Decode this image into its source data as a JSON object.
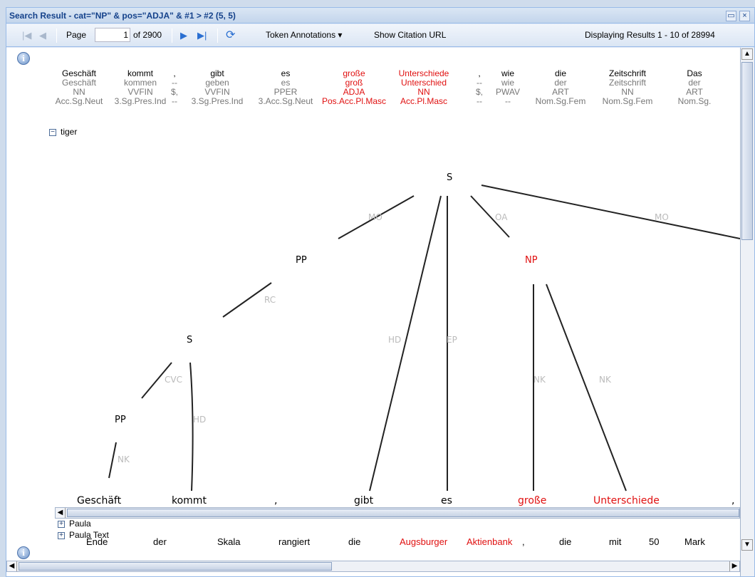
{
  "window": {
    "title": "Search Result - cat=\"NP\" & pos=\"ADJA\" & #1 > #2 (5, 5)",
    "restore_glyph": "▭",
    "close_glyph": "×"
  },
  "toolbar": {
    "page_label": "Page",
    "page_value": "1",
    "of_pages": "of 2900",
    "token_annotations": "Token Annotations ▾",
    "show_citation": "Show Citation URL",
    "displaying": "Displaying Results 1 - 10 of 28994",
    "first_icon": "first-page-icon",
    "prev_icon": "prev-page-icon",
    "next_icon": "next-page-icon",
    "last_icon": "last-page-icon",
    "refresh_icon": "refresh-icon"
  },
  "result1": {
    "info_glyph": "i",
    "tokens": [
      {
        "word": "Geschäft",
        "lemma": "Geschäft",
        "pos": "NN",
        "morph": "Acc.Sg.Neut",
        "hl": false
      },
      {
        "word": "kommt",
        "lemma": "kommen",
        "pos": "VVFIN",
        "morph": "3.Sg.Pres.Ind",
        "hl": false
      },
      {
        "word": ",",
        "lemma": "--",
        "pos": "$,",
        "morph": "--",
        "hl": false
      },
      {
        "word": "gibt",
        "lemma": "geben",
        "pos": "VVFIN",
        "morph": "3.Sg.Pres.Ind",
        "hl": false
      },
      {
        "word": "es",
        "lemma": "es",
        "pos": "PPER",
        "morph": "3.Acc.Sg.Neut",
        "hl": false
      },
      {
        "word": "große",
        "lemma": "groß",
        "pos": "ADJA",
        "morph": "Pos.Acc.Pl.Masc",
        "hl": true
      },
      {
        "word": "Unterschiede",
        "lemma": "Unterschied",
        "pos": "NN",
        "morph": "Acc.Pl.Masc",
        "hl": true
      },
      {
        "word": ",",
        "lemma": "--",
        "pos": "$,",
        "morph": "--",
        "hl": false
      },
      {
        "word": "wie",
        "lemma": "wie",
        "pos": "PWAV",
        "morph": "--",
        "hl": false
      },
      {
        "word": "die",
        "lemma": "der",
        "pos": "ART",
        "morph": "Nom.Sg.Fem",
        "hl": false
      },
      {
        "word": "Zeitschrift",
        "lemma": "Zeitschrift",
        "pos": "NN",
        "morph": "Nom.Sg.Fem",
        "hl": false
      },
      {
        "word": "Das",
        "lemma": "der",
        "pos": "ART",
        "morph": "Nom.Sg.",
        "hl": false
      }
    ],
    "tiger_label": "tiger",
    "tree": {
      "nodes": [
        "S",
        "PP",
        "NP",
        "S",
        "PP"
      ],
      "edges": [
        "MO",
        "OA",
        "MO",
        "RC",
        "HD",
        "EP",
        "NK",
        "NK",
        "CVC",
        "HD",
        "NK"
      ],
      "leaves": [
        "Geschäft",
        "kommt",
        ",",
        "gibt",
        "es",
        "große",
        "Unterschiede",
        ","
      ]
    },
    "paula_label": "Paula",
    "paula_text_label": "Paula Text"
  },
  "result2": {
    "info_glyph": "i",
    "tokens": [
      "Ende",
      "der",
      "Skala",
      "rangiert",
      "die",
      "Augsburger",
      "Aktienbank",
      ",",
      "die",
      "mit",
      "50",
      "Mark"
    ],
    "highlighted": [
      5,
      6
    ]
  },
  "colors": {
    "highlight": "#e01010",
    "title": "#15428b",
    "border": "#99bbe8"
  }
}
